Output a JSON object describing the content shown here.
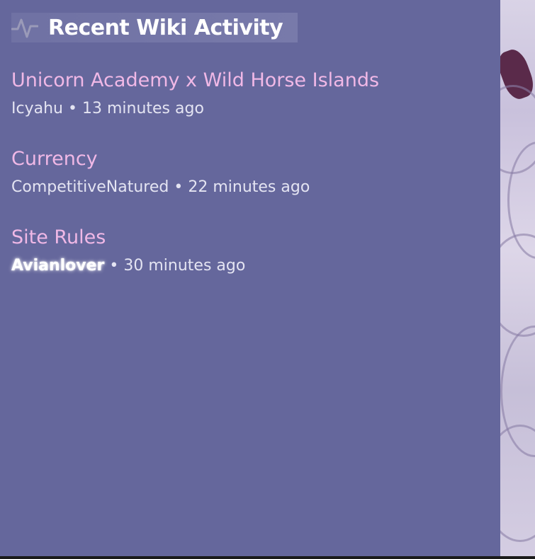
{
  "header": {
    "icon": "activity-pulse-icon",
    "title": "Recent Wiki Activity"
  },
  "activity": [
    {
      "page": "Unicorn Academy x Wild Horse Islands",
      "user": "Icyahu",
      "separator": "•",
      "time": "13 minutes ago"
    },
    {
      "page": "Currency",
      "user": "CompetitiveNatured",
      "separator": "•",
      "time": "22 minutes ago"
    },
    {
      "page": "Site Rules",
      "user": "Avianlover",
      "separator": "•",
      "time": "30 minutes ago"
    }
  ],
  "colors": {
    "panel_background": "#65679c",
    "link_pink": "#f0b8e6",
    "meta_text": "#e4e4f2",
    "header_text": "#ffffff"
  }
}
